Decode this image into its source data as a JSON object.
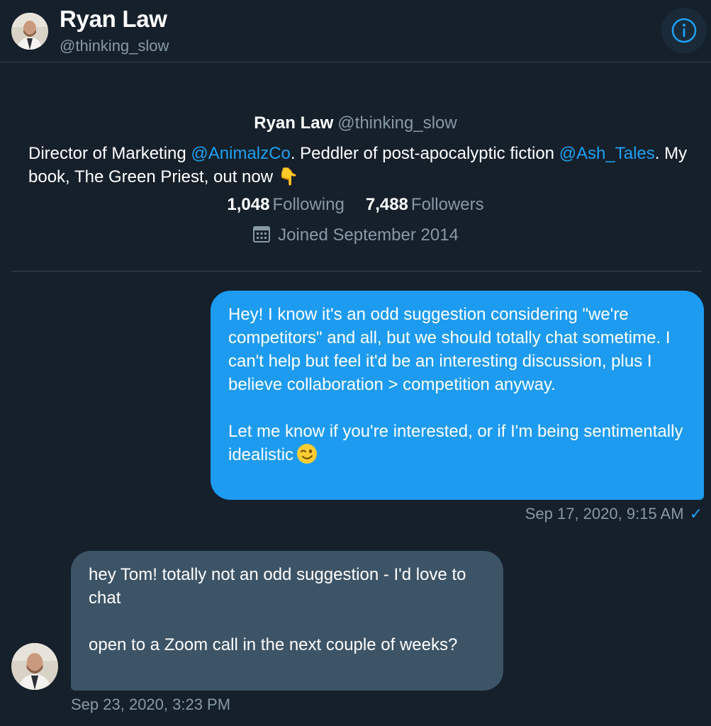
{
  "header": {
    "name": "Ryan Law",
    "handle": "@thinking_slow",
    "info_icon": "info-circle-icon",
    "accent_color": "#1da1f2"
  },
  "profile": {
    "name": "Ryan Law",
    "handle": "@thinking_slow",
    "bio": {
      "part1": "Director of Marketing ",
      "mention1": "@AnimalzCo",
      "part2": ". Peddler of post-apocalyptic fiction ",
      "mention2": "@Ash_Tales",
      "part3": ". My book, The Green Priest, out now ",
      "emoji": "👇"
    },
    "following_count": "1,048",
    "following_label": "Following",
    "followers_count": "7,488",
    "followers_label": "Followers",
    "joined": "Joined September 2014",
    "joined_icon": "calendar-icon"
  },
  "messages": [
    {
      "direction": "outgoing",
      "paragraphs": [
        "Hey! I know it's an odd suggestion considering \"we're competitors\" and all, but we should totally chat sometime. I can't help but feel it'd be an interesting discussion, plus I believe collaboration > competition anyway.",
        "Let me know if you're interested, or if I'm being sentimentally idealistic"
      ],
      "emoji": "😉",
      "timestamp": "Sep 17, 2020, 9:15 AM",
      "status_icon": "checkmark-icon",
      "status_glyph": "✓"
    },
    {
      "direction": "incoming",
      "paragraphs": [
        "hey Tom! totally not an odd suggestion - I'd love to chat",
        "open to a Zoom call in the next couple of weeks?"
      ],
      "timestamp": "Sep 23, 2020, 3:23 PM"
    }
  ],
  "colors": {
    "background": "#15202b",
    "outgoing_bubble": "#1d9bf0",
    "incoming_bubble": "#3d5466",
    "secondary_text": "#8899a6",
    "link": "#1da1f2"
  }
}
